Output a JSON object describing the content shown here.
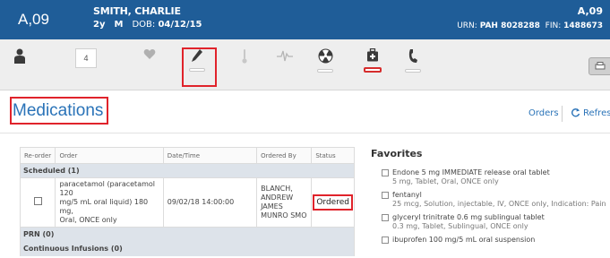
{
  "patient": {
    "bed": "A,09",
    "name": "SMITH, CHARLIE",
    "age": "2y",
    "sex": "M",
    "dob_label": "DOB:",
    "dob": "04/12/15",
    "bed_right": "A,09",
    "urn_label": "URN:",
    "urn": "PAH 8028288",
    "fin_label": "FIN:",
    "fin": "1488673"
  },
  "toolbar": {
    "count_badge": "4",
    "icons": [
      "person-icon",
      "count-badge",
      "heart-icon",
      "pencil-icon",
      "thermometer-icon",
      "pulse-icon",
      "radiation-icon",
      "medkit-icon",
      "phone-icon",
      "print-button"
    ],
    "highlight_color": "#e0232b"
  },
  "page": {
    "title": "Medications",
    "orders_link": "Orders",
    "refresh_link": "Refresh"
  },
  "med_table": {
    "headers": [
      "Re-order",
      "Order",
      "Date/Time",
      "Ordered By",
      "Status"
    ],
    "groups": [
      {
        "label": "Scheduled (1)",
        "rows": [
          {
            "order_line1": "paracetamol (paracetamol 120",
            "order_line2": "mg/5 mL oral liquid) 180 mg,",
            "order_line3": "Oral, ONCE only",
            "datetime": "09/02/18 14:00:00",
            "ordered_by_line1": "BLANCH,",
            "ordered_by_line2": "ANDREW JAMES",
            "ordered_by_line3": "MUNRO SMO",
            "status": "Ordered"
          }
        ]
      },
      {
        "label": "PRN (0)"
      },
      {
        "label": "Continuous Infusions (0)"
      }
    ]
  },
  "favorites": {
    "title": "Favorites",
    "items": [
      {
        "name": "Endone 5 mg IMMEDIATE release oral tablet",
        "detail": "5 mg, Tablet, Oral, ONCE only"
      },
      {
        "name": "fentanyl",
        "detail": "25 mcg, Solution, injectable, IV, ONCE only, Indication: Pain"
      },
      {
        "name": "glyceryl trinitrate 0.6 mg sublingual tablet",
        "detail": "0.3 mg, Tablet, Sublingual, ONCE only"
      },
      {
        "name": "ibuprofen 100 mg/5 mL oral suspension",
        "detail": ""
      }
    ]
  },
  "colors": {
    "header_bg": "#1f5d98",
    "link": "#2a73b8",
    "group_row_bg": "#dde3ea",
    "highlight": "#e0232b"
  }
}
